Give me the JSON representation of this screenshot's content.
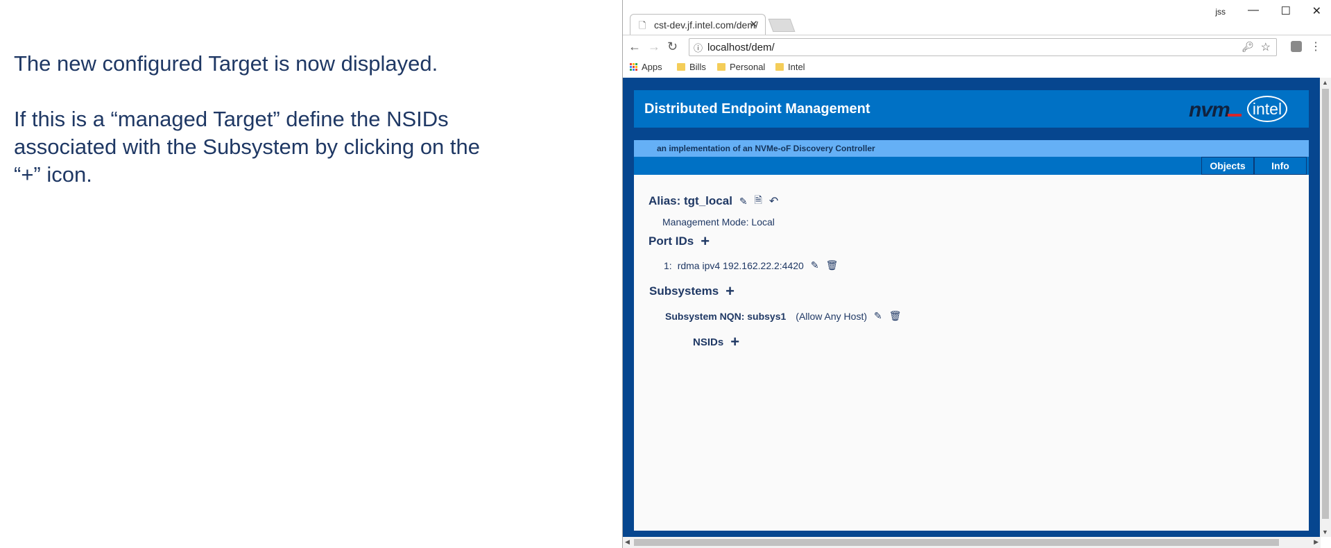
{
  "caption": {
    "line1": "The new configured Target is now displayed.",
    "line2": "If this is a “managed Target” define the NSIDs",
    "line3": "associated with the Subsystem by clicking on the",
    "line4": "“+” icon."
  },
  "browser": {
    "tab_title": "cst-dev.jf.intel.com/dem/",
    "tab_close": "✕",
    "window_controls": {
      "user": "jss",
      "minimize": "—",
      "maximize": "☐",
      "close": "✕"
    },
    "url": "localhost/dem/",
    "bookmarks": [
      {
        "label": "Apps",
        "icon": "apps-grid-icon"
      },
      {
        "label": "Bills",
        "icon": "folder-icon"
      },
      {
        "label": "Personal",
        "icon": "folder-icon"
      },
      {
        "label": "Intel",
        "icon": "folder-icon"
      }
    ]
  },
  "app": {
    "title": "Distributed Endpoint Management",
    "logo_nvm": "nvm",
    "logo_intel": "intel",
    "subtitle": "an implementation of an NVMe-oF Discovery Controller",
    "nav": {
      "objects": "Objects",
      "info": "Info"
    },
    "target": {
      "alias": "Alias: tgt_local",
      "mode": "Management Mode: Local",
      "port_ids_heading": "Port IDs",
      "ports": [
        {
          "index": "1:",
          "value": "rdma ipv4 192.162.22.2:4420"
        }
      ],
      "subsystems_heading": "Subsystems",
      "subsystem_nqn": "Subsystem NQN: subsys1",
      "subsystem_note": "(Allow Any Host)",
      "nsids_heading": "NSIDs"
    }
  },
  "colors": {
    "frame": "#06468f",
    "banner": "#0071c5",
    "subbar": "#65b0f6",
    "text": "#1f3864"
  }
}
